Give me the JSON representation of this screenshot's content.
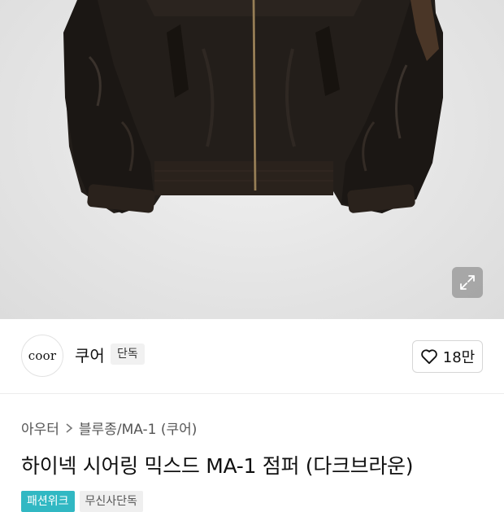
{
  "brand": {
    "logo_text": "coor",
    "name": "쿠어",
    "badge": "단독"
  },
  "like": {
    "count": "18만"
  },
  "breadcrumb": {
    "category": "아우터",
    "subcategory": "블루종/MA-1 (쿠어)"
  },
  "product": {
    "title": "하이넥 시어링 믹스드 MA-1 점퍼 (다크브라운)"
  },
  "tags": [
    "패션위크",
    "무신사단독"
  ],
  "icons": {
    "expand": "expand-icon",
    "heart": "heart-icon",
    "chevron": "chevron-right-icon"
  }
}
